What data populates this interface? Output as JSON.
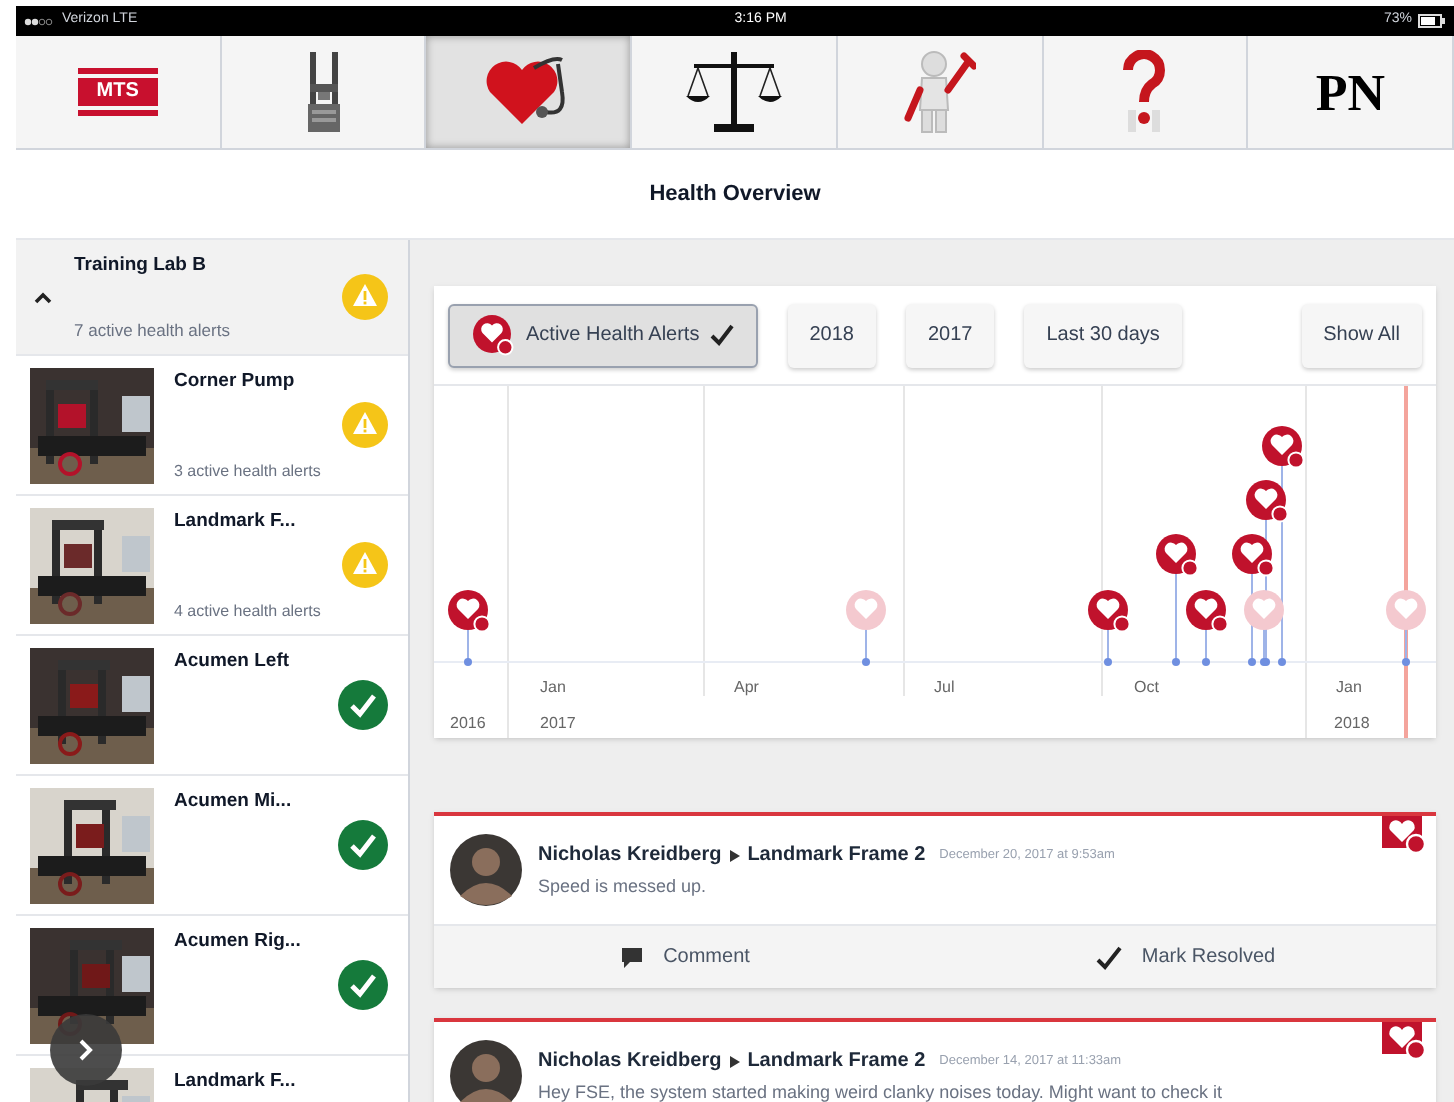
{
  "status_bar": {
    "carrier": "Verizon LTE",
    "time": "3:16 PM",
    "battery": "73%"
  },
  "toolbar": [
    {
      "kind": "logo",
      "label": "MTS",
      "selected": false
    },
    {
      "kind": "frame",
      "selected": false
    },
    {
      "kind": "health",
      "selected": true
    },
    {
      "kind": "scales",
      "selected": false
    },
    {
      "kind": "service",
      "selected": false
    },
    {
      "kind": "help",
      "selected": false
    },
    {
      "kind": "text",
      "label": "PN",
      "selected": false
    }
  ],
  "title": "Health Overview",
  "sidebar": {
    "group": {
      "name": "Training Lab B",
      "alerts": "7 active health alerts",
      "expanded": true,
      "alert": true
    },
    "items": [
      {
        "name": "Corner Pump",
        "alerts": "3 active health alerts",
        "alert": true
      },
      {
        "name": "Landmark F...",
        "alerts": "4 active health alerts",
        "alert": true
      },
      {
        "name": "Acumen Left",
        "alert": false
      },
      {
        "name": "Acumen Mi...",
        "alert": false
      },
      {
        "name": "Acumen Rig...",
        "alert": false
      },
      {
        "name": "Landmark F..."
      }
    ]
  },
  "filters": [
    {
      "label": "Active Health Alerts",
      "selected": true
    },
    {
      "label": "2018",
      "selected": false
    },
    {
      "label": "2017",
      "selected": false
    },
    {
      "label": "Last 30 days",
      "selected": false
    },
    {
      "label": "Show All",
      "selected": false
    }
  ],
  "timeline": {
    "months": [
      "Jan",
      "Apr",
      "Jul",
      "Oct",
      "Jan"
    ],
    "years": [
      "2016",
      "2017",
      "2018"
    ]
  },
  "alerts": [
    {
      "author": "Nicholas Kreidberg",
      "target": "Landmark Frame 2",
      "date": "December 20, 2017 at 9:53am",
      "message": "Speed is messed up.",
      "actions": [
        {
          "kind": "comment",
          "label": "Comment"
        },
        {
          "kind": "resolve",
          "label": "Mark Resolved"
        }
      ]
    },
    {
      "author": "Nicholas Kreidberg",
      "target": "Landmark Frame 2",
      "date": "December 14, 2017 at 11:33am",
      "message": "Hey FSE, the system started making weird clanky noises today. Might want to check it"
    }
  ]
}
